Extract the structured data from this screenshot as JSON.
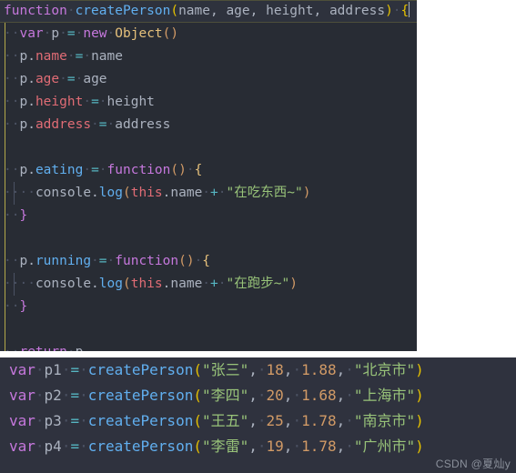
{
  "editor": {
    "background": "#282c34",
    "active_line_background": "#2e323d",
    "lines": [
      {
        "id": "line-1",
        "text": "function createPerson(name, age, height, address) {",
        "active": true
      },
      {
        "id": "line-2",
        "text": "  var p = new Object()"
      },
      {
        "id": "line-3",
        "text": "  p.name = name"
      },
      {
        "id": "line-4",
        "text": "  p.age = age"
      },
      {
        "id": "line-5",
        "text": "  p.height = height"
      },
      {
        "id": "line-6",
        "text": "  p.address = address"
      },
      {
        "id": "line-7",
        "text": ""
      },
      {
        "id": "line-8",
        "text": "  p.eating = function() {"
      },
      {
        "id": "line-9",
        "text": "    console.log(this.name + \"在吃东西~\")"
      },
      {
        "id": "line-10",
        "text": "  }"
      },
      {
        "id": "line-11",
        "text": ""
      },
      {
        "id": "line-12",
        "text": "  p.running = function() {"
      },
      {
        "id": "line-13",
        "text": "    console.log(this.name + \"在跑步~\")"
      },
      {
        "id": "line-14",
        "text": "  }"
      },
      {
        "id": "line-15",
        "text": ""
      },
      {
        "id": "line-16",
        "text": "  return p"
      },
      {
        "id": "line-17",
        "text": "}"
      }
    ],
    "tokens": {
      "kw_function": "function",
      "fn_createPerson": "createPerson",
      "params": "name, age, height, address",
      "kw_var": "var",
      "kw_new": "new",
      "kw_return": "return",
      "obj_Object": "Object",
      "ident_p": "p",
      "prop_name": "name",
      "prop_age": "age",
      "prop_height": "height",
      "prop_address": "address",
      "prop_eating": "eating",
      "prop_running": "running",
      "ident_console": "console",
      "fn_log": "log",
      "kw_this": "this",
      "str_eating": "\"在吃东西~\"",
      "str_running": "\"在跑步~\"",
      "op_assign": "=",
      "op_plus": "+",
      "op_dot": ".",
      "brace_open": "{",
      "brace_close": "}",
      "paren_open": "(",
      "paren_close": ")"
    },
    "colors": {
      "keyword": "#c678dd",
      "function_name": "#61afef",
      "property": "#e06c75",
      "string": "#98c379",
      "number": "#d19a66",
      "operator": "#56b6c2",
      "brace_highlight": "#e5c100",
      "plain": "#abb2bf",
      "guide": "#b3a84a"
    }
  },
  "usage": {
    "background": "#2f323e",
    "calls": [
      {
        "kw": "var",
        "name": "p1",
        "fn": "createPerson",
        "person": "\"张三\"",
        "age": "18",
        "height": "1.88",
        "city": "\"北京市\""
      },
      {
        "kw": "var",
        "name": "p2",
        "fn": "createPerson",
        "person": "\"李四\"",
        "age": "20",
        "height": "1.68",
        "city": "\"上海市\""
      },
      {
        "kw": "var",
        "name": "p3",
        "fn": "createPerson",
        "person": "\"王五\"",
        "age": "25",
        "height": "1.78",
        "city": "\"南京市\""
      },
      {
        "kw": "var",
        "name": "p4",
        "fn": "createPerson",
        "person": "\"李雷\"",
        "age": "19",
        "height": "1.78",
        "city": "\"广州市\""
      }
    ]
  },
  "watermark": {
    "text": "CSDN @夏灿y"
  }
}
